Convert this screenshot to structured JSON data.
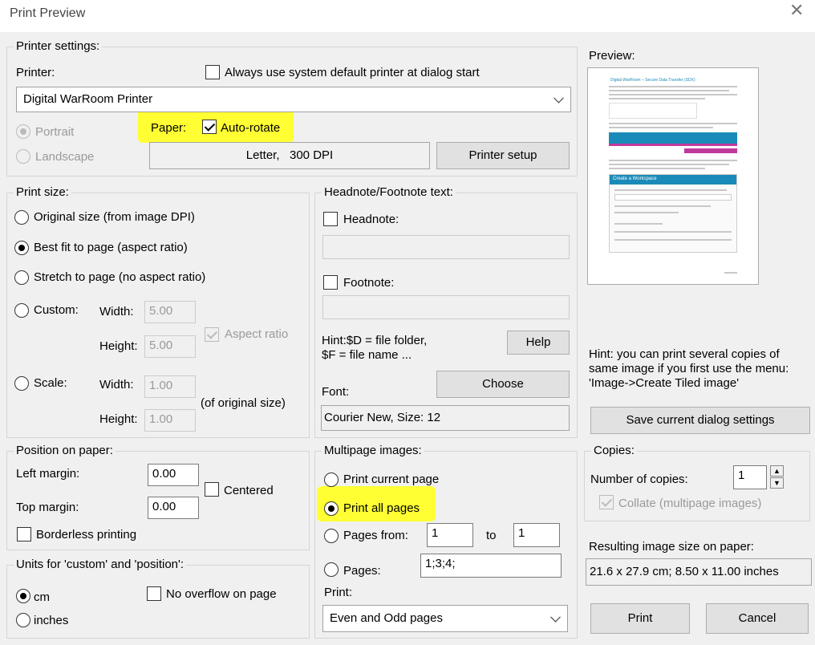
{
  "window": {
    "title": "Print Preview",
    "close_glyph": "✕"
  },
  "printer_settings": {
    "legend": "Printer settings:",
    "printer_label": "Printer:",
    "always_default_label": "Always use system default printer at dialog start",
    "always_default_checked": false,
    "printer_selected": "Digital WarRoom Printer",
    "portrait_label": "Portrait",
    "landscape_label": "Landscape",
    "paper_label": "Paper:",
    "autorotate_label": "Auto-rotate",
    "autorotate_checked": true,
    "paper_info": "Letter,   300 DPI",
    "printer_setup_label": "Printer setup"
  },
  "preview": {
    "label": "Preview:",
    "page_doc_title": "Digital WarRoom – Secure Data Transfer (SDX)",
    "page_dialog_title": "Create a Workspace"
  },
  "print_size": {
    "legend": "Print size:",
    "options": [
      "Original size (from image DPI)",
      "Best fit to page (aspect ratio)",
      "Stretch to page (no aspect ratio)"
    ],
    "selected_index": 1,
    "custom_label": "Custom:",
    "width_label": "Width:",
    "height_label": "Height:",
    "custom_width": "5.00",
    "custom_height": "5.00",
    "aspect_ratio_label": "Aspect ratio",
    "aspect_ratio_checked": true,
    "scale_label": "Scale:",
    "scale_width": "1.00",
    "scale_height": "1.00",
    "of_original_label": "(of original size)"
  },
  "headnote": {
    "legend": "Headnote/Footnote text:",
    "headnote_label": "Headnote:",
    "headnote_value": "",
    "footnote_label": "Footnote:",
    "footnote_value": "",
    "hint_line1": "Hint:$D = file folder,",
    "hint_line2": "$F = file name ...",
    "help_label": "Help",
    "choose_label": "Choose",
    "font_label": "Font:",
    "font_value": "Courier New, Size: 12"
  },
  "hint_right": {
    "line1": "Hint: you can print several copies of",
    "line2": "same image if you first use the menu:",
    "line3": "'Image->Create Tiled image'"
  },
  "save_settings_label": "Save current dialog settings",
  "position": {
    "legend": "Position on paper:",
    "left_margin_label": "Left margin:",
    "left_margin": "0.00",
    "top_margin_label": "Top margin:",
    "top_margin": "0.00",
    "centered_label": "Centered",
    "borderless_label": "Borderless printing"
  },
  "units": {
    "legend": "Units for 'custom' and 'position':",
    "cm_label": "cm",
    "inches_label": "inches",
    "selected": "cm",
    "no_overflow_label": "No overflow on page"
  },
  "multipage": {
    "legend": "Multipage images:",
    "current_label": "Print current page",
    "all_label": "Print all pages",
    "from_label": "Pages from:",
    "from_value": "1",
    "to_label": "to",
    "to_value": "1",
    "pages_label": "Pages:",
    "pages_value": "1;3;4;",
    "selected": "all",
    "print_label": "Print:",
    "print_selected": "Even and Odd pages"
  },
  "copies": {
    "legend": "Copies:",
    "number_label": "Number of copies:",
    "number_value": "1",
    "collate_label": "Collate (multipage images)",
    "collate_checked": true
  },
  "result": {
    "label": "Resulting image size on paper:",
    "value": "21.6 x 27.9 cm; 8.50 x 11.00 inches"
  },
  "print_button": "Print",
  "cancel_button": "Cancel",
  "colors": {
    "highlight": "#ffff33",
    "dialog_bg": "#f0f0f0",
    "button_bg": "#e1e1e1",
    "preview_accent": "#1a8bb8"
  }
}
